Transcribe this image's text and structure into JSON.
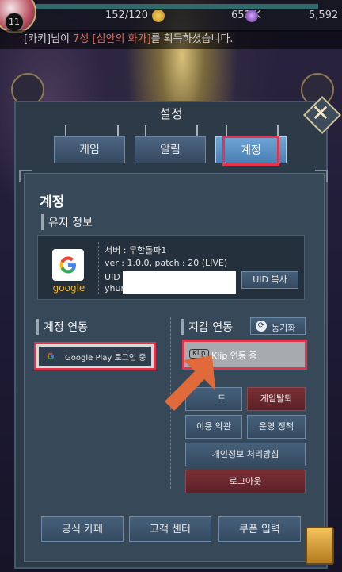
{
  "hud": {
    "level": "11",
    "stamina": "152/120",
    "gold": "651 K",
    "gem": "5,592"
  },
  "ticker": {
    "prefix": "[카키]님이 ",
    "highlight": "7성 [심안의 화가]",
    "suffix": "를 획득하셨습니다."
  },
  "dialog": {
    "title": "설정",
    "tabs": [
      "게임",
      "알림",
      "계정"
    ],
    "active_tab": "계정",
    "heading": "계정",
    "user_info": {
      "section_title": "유저 정보",
      "provider": "google",
      "server_line": "서버 : 무한돌파1",
      "version_line": "ver : 1.0.0, patch : 20 (LIVE)",
      "uid_label": "UID :",
      "uid_partial": "yhur",
      "copy_button": "UID 복사"
    },
    "account_link": {
      "section_title": "계정 연동",
      "google_button": "Google Play 로그인 중"
    },
    "wallet_link": {
      "section_title": "지갑 연동",
      "sync_button": "동기화",
      "klip_badge": "Klip",
      "klip_button": "Klip 연동 중"
    },
    "buttons": {
      "guide_partial": "드",
      "withdraw": "게임탈퇴",
      "terms": "이용 약관",
      "policy": "운영 정책",
      "privacy": "개인정보 처리방침",
      "logout": "로그아웃"
    },
    "footer": [
      "공식 카페",
      "고객 센터",
      "쿠폰 입력"
    ]
  },
  "colors": {
    "highlight_red": "#e0364d",
    "arrow_orange": "#e06a3a",
    "google_yellow": "#f2b431"
  }
}
